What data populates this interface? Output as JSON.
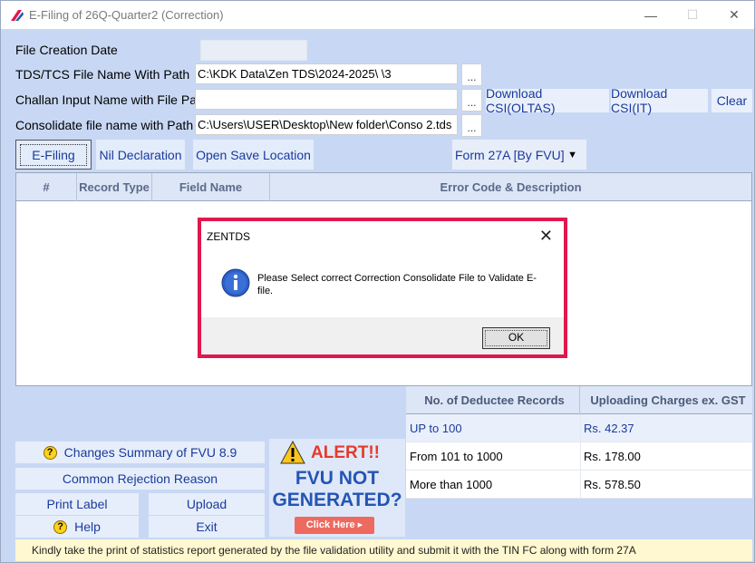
{
  "window": {
    "title": "E-Filing of 26Q-Quarter2 (Correction)",
    "minimize": "—",
    "maximize": "☐",
    "close": "✕"
  },
  "form": {
    "file_creation_date_label": "File Creation Date",
    "file_creation_date_value": "",
    "tds_file_label": "TDS/TCS File Name With Path",
    "tds_file_value": "C:\\KDK Data\\Zen TDS\\2024-2025\\                 \\3",
    "challan_label": "Challan Input Name with File Path",
    "challan_value": "",
    "consolidate_label": "Consolidate file name with Path",
    "consolidate_value": "C:\\Users\\USER\\Desktop\\New folder\\Conso 2.tds",
    "browse": "...",
    "download_oltas": "Download CSI(OLTAS)",
    "download_it": "Download CSI(IT)",
    "clear": "Clear"
  },
  "actions": {
    "efiling": "E-Filing",
    "nil": "Nil Declaration",
    "open_save": "Open Save Location",
    "form_select": "Form 27A [By FVU]",
    "dropdown_arrow": "▼"
  },
  "grid": {
    "columns": [
      "#",
      "Record Type",
      "Field Name",
      "Error Code & Description"
    ]
  },
  "dialog": {
    "title": "ZENTDS",
    "close": "✕",
    "message": "Please Select correct Correction Consolidate File to Validate E-file.",
    "ok": "OK",
    "icon": "info-icon"
  },
  "pricing": {
    "headers": [
      "No. of Deductee Records",
      "Uploading Charges ex. GST"
    ],
    "rows": [
      [
        "UP to 100",
        "Rs. 42.37"
      ],
      [
        "From 101 to 1000",
        "Rs. 178.00"
      ],
      [
        "More than 1000",
        "Rs. 578.50"
      ]
    ]
  },
  "side": {
    "changes": "Changes Summary of FVU 8.9",
    "rejection": "Common Rejection Reason",
    "print": "Print Label",
    "upload": "Upload",
    "help": "Help",
    "exit": "Exit",
    "q_mark": "?"
  },
  "alert": {
    "title": "ALERT!!",
    "line1": "FVU NOT",
    "line2": "GENERATED?",
    "cta": "Click Here ▸"
  },
  "footer": "Kindly take the print of statistics report generated by the file validation utility and submit it with the TIN FC along with form 27A",
  "colors": {
    "accent": "#1a3a9b",
    "dialog_border": "#e0184e",
    "alert_red": "#e63a2a",
    "alert_blue": "#2455b5"
  }
}
